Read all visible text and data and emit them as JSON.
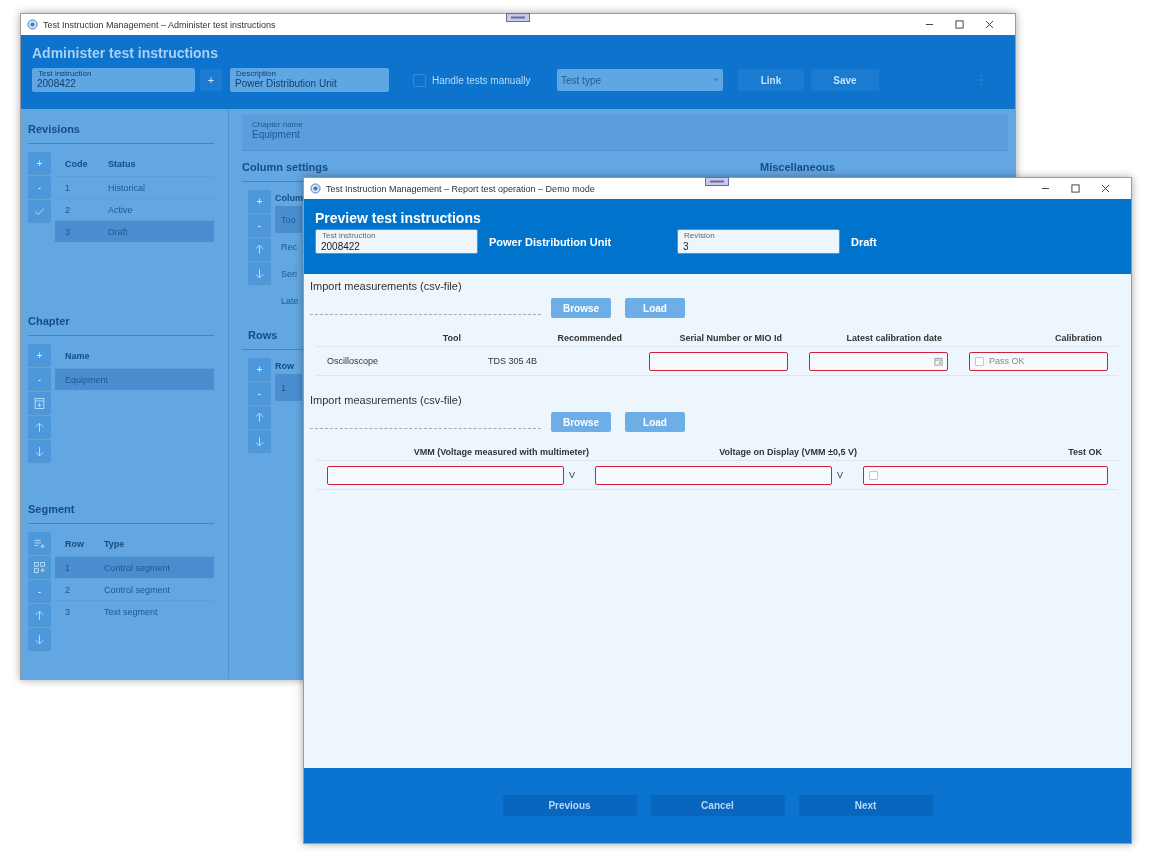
{
  "back_window": {
    "title": "Test Instruction Management – Administer test instructions",
    "header": {
      "title": "Administer test instructions",
      "test_instruction": {
        "label": "Test instruction",
        "value": "2008422"
      },
      "add_button": "+",
      "description": {
        "label": "Description",
        "value": "Power Distribution Unit"
      },
      "handle_tests_manually": {
        "label": "Handle tests manually",
        "checked": false
      },
      "test_type": {
        "placeholder": "Test type"
      },
      "buttons": [
        "Link",
        "Save"
      ]
    },
    "revisions": {
      "heading": "Revisions",
      "tools": [
        {
          "kind": "plus",
          "label": "+"
        },
        {
          "kind": "minus",
          "label": "-"
        },
        {
          "kind": "check"
        }
      ],
      "columns": [
        "Code",
        "Status"
      ],
      "rows": [
        {
          "cells": [
            "1",
            "Historical"
          ],
          "selected": false
        },
        {
          "cells": [
            "2",
            "Active"
          ],
          "selected": false
        },
        {
          "cells": [
            "3",
            "Draft"
          ],
          "selected": true
        }
      ]
    },
    "chapter": {
      "heading": "Chapter",
      "tools": [
        {
          "kind": "plus",
          "label": "+"
        },
        {
          "kind": "minus",
          "label": "-"
        },
        {
          "kind": "archive"
        },
        {
          "kind": "up"
        },
        {
          "kind": "down"
        }
      ],
      "columns": [
        "Name"
      ],
      "rows": [
        {
          "cells": [
            "Equipment"
          ],
          "selected": true
        }
      ]
    },
    "segment": {
      "heading": "Segment",
      "tools": [
        {
          "kind": "list_add"
        },
        {
          "kind": "grid_add"
        },
        {
          "kind": "minus",
          "label": "-"
        },
        {
          "kind": "up"
        },
        {
          "kind": "down"
        }
      ],
      "columns": [
        "Row",
        "Type"
      ],
      "rows": [
        {
          "cells": [
            "1",
            "Control segment"
          ],
          "selected": true
        },
        {
          "cells": [
            "2",
            "Control segment"
          ],
          "selected": false
        },
        {
          "cells": [
            "3",
            "Text segment"
          ],
          "selected": false
        }
      ]
    },
    "chapter_name": {
      "label": "Chapter name",
      "value": "Equipment"
    },
    "column_settings": {
      "heading": "Column settings",
      "tools": [
        {
          "kind": "plus",
          "label": "+"
        },
        {
          "kind": "minus",
          "label": "-"
        },
        {
          "kind": "up"
        },
        {
          "kind": "down"
        }
      ],
      "column": "Colum",
      "rows": [
        {
          "text": "Too",
          "selected": true
        },
        {
          "text": "Rec",
          "selected": false
        },
        {
          "text": "Seri",
          "selected": false
        },
        {
          "text": "Late",
          "selected": false
        }
      ]
    },
    "rows_panel": {
      "heading": "Rows",
      "tools": [
        {
          "kind": "plus",
          "label": "+"
        },
        {
          "kind": "minus",
          "label": "-"
        },
        {
          "kind": "up"
        },
        {
          "kind": "down"
        }
      ],
      "column": "Row",
      "rows": [
        {
          "text": "1",
          "selected": true
        }
      ]
    },
    "miscellaneous": {
      "heading": "Miscellaneous"
    }
  },
  "front_window": {
    "title": "Test Instruction Management – Report test operation – Demo mode",
    "header": {
      "title": "Preview test instructions",
      "test_instruction": {
        "label": "Test instruction",
        "value": "2008422"
      },
      "description": "Power Distribution Unit",
      "revision": {
        "label": "Revision",
        "value": "3"
      },
      "status": "Draft"
    },
    "sections": [
      {
        "heading": "Import measurements (csv-file)",
        "buttons": [
          "Browse",
          "Load"
        ],
        "columns": [
          "Tool",
          "Recommended",
          "Serial Number or MIO Id",
          "Latest calibration date",
          "Calibration"
        ],
        "cells": [
          {
            "kind": "text",
            "text": "Oscilloscope"
          },
          {
            "kind": "text",
            "text": "TDS 305 4B"
          },
          {
            "kind": "field",
            "invalid": true
          },
          {
            "kind": "date",
            "invalid": true
          },
          {
            "kind": "checkbox",
            "label": "Pass OK",
            "checked": false,
            "invalid": true
          }
        ]
      },
      {
        "heading": "Import measurements (csv-file)",
        "buttons": [
          "Browse",
          "Load"
        ],
        "columns": [
          "VMM (Voltage measured with multimeter)",
          "Voltage on Display (VMM ±0,5 V)",
          "Test OK"
        ],
        "cells": [
          {
            "kind": "field",
            "unit": "V",
            "invalid": true
          },
          {
            "kind": "field",
            "unit": "V",
            "invalid": true
          },
          {
            "kind": "checkbox",
            "checked": false,
            "invalid": true
          }
        ]
      }
    ],
    "footer_buttons": [
      "Previous",
      "Cancel",
      "Next"
    ]
  }
}
